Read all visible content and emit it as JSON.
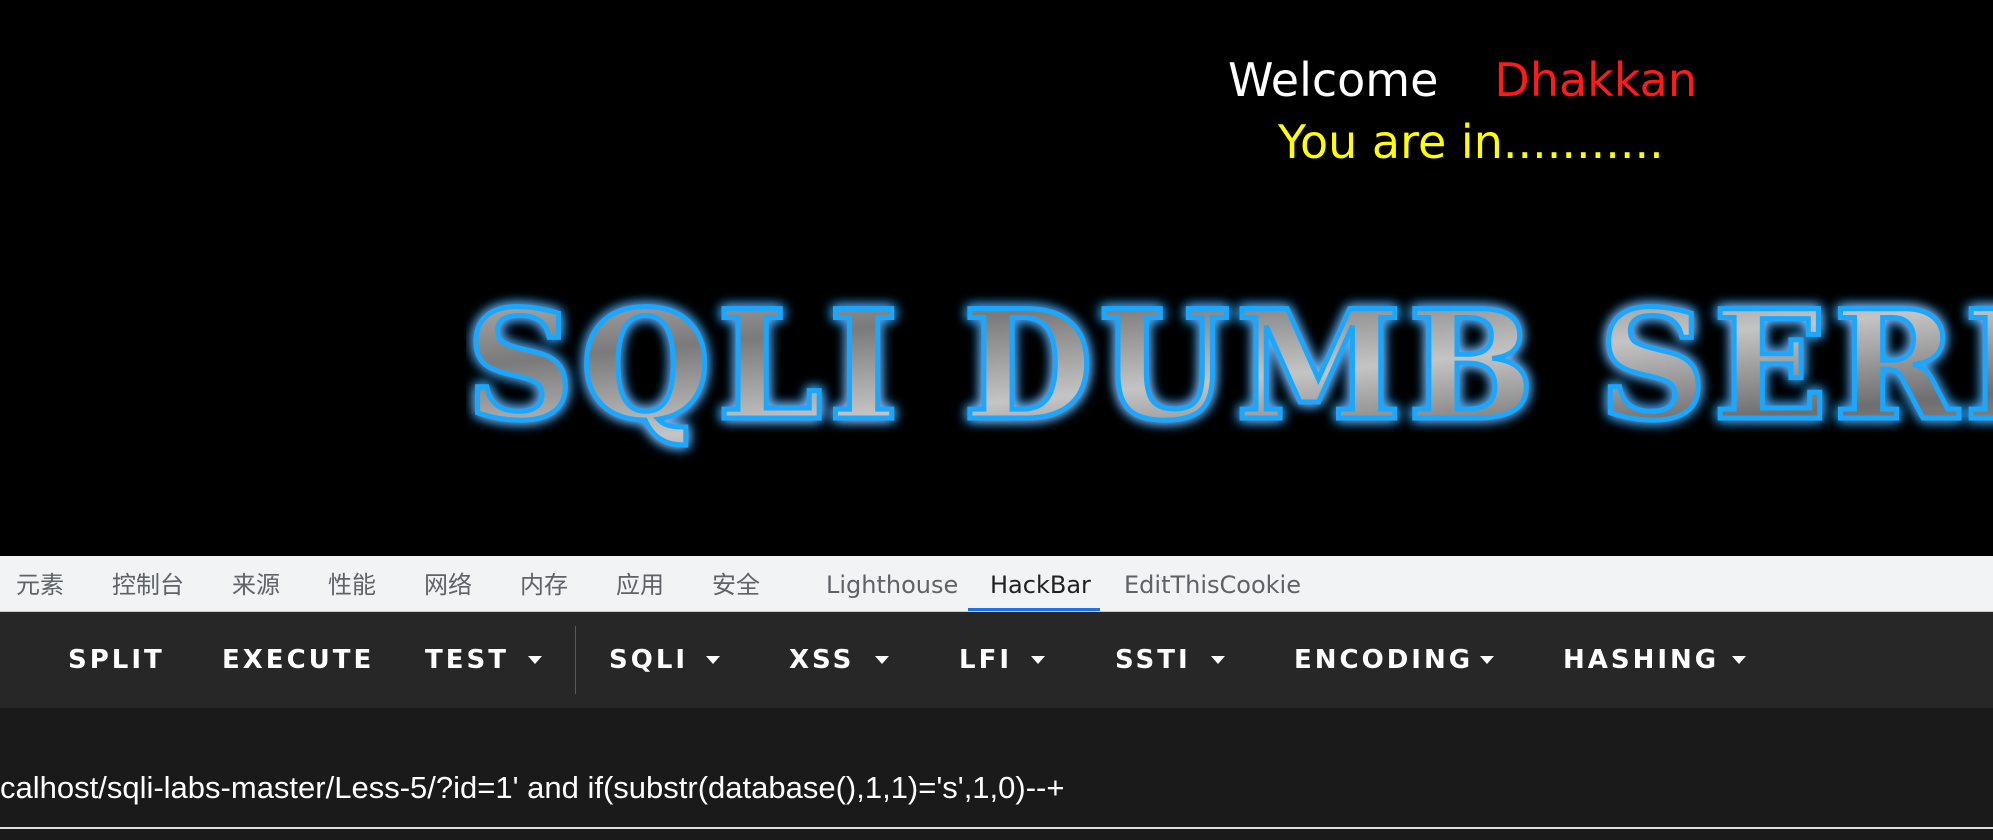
{
  "page": {
    "welcome_label": "Welcome",
    "welcome_name": "Dhakkan",
    "status_message": "You are in...........",
    "banner_text": "SQLI DUMB SERIES"
  },
  "devtools": {
    "tabs": [
      {
        "label": "元素"
      },
      {
        "label": "控制台"
      },
      {
        "label": "来源"
      },
      {
        "label": "性能"
      },
      {
        "label": "网络"
      },
      {
        "label": "内存"
      },
      {
        "label": "应用"
      },
      {
        "label": "安全"
      },
      {
        "label": "Lighthouse"
      },
      {
        "label": "HackBar",
        "active": true
      },
      {
        "label": "EditThisCookie"
      }
    ]
  },
  "hackbar": {
    "buttons": [
      {
        "label": "SPLIT",
        "dropdown": false
      },
      {
        "label": "EXECUTE",
        "dropdown": false
      },
      {
        "label": "TEST",
        "dropdown": true
      },
      {
        "label": "SQLI",
        "dropdown": true
      },
      {
        "label": "XSS",
        "dropdown": true
      },
      {
        "label": "LFI",
        "dropdown": true
      },
      {
        "label": "SSTI",
        "dropdown": true
      },
      {
        "label": "ENCODING",
        "dropdown": true
      },
      {
        "label": "HASHING",
        "dropdown": true
      }
    ],
    "url_value": "calhost/sqli-labs-master/Less-5/?id=1' and if(substr(database(),1,1)='s',1,0)--+"
  },
  "colors": {
    "welcome": "#ffffff",
    "name": "#ff1a1a",
    "status": "#ffff00",
    "banner_glow": "#1aa7ff",
    "toolbar_bg": "#272727",
    "url_bg": "#1a1a1a",
    "tab_active_underline": "#1a73e8"
  }
}
